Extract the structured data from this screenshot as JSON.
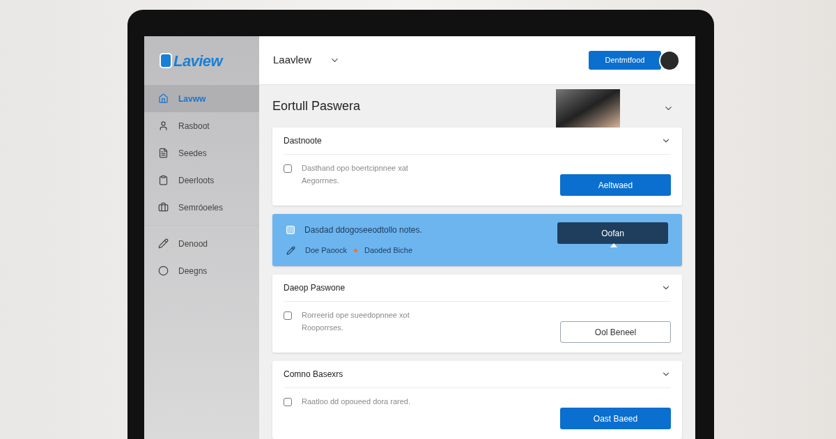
{
  "app": {
    "logo": "Laview"
  },
  "sidebar": {
    "groups": [
      [
        {
          "label": "Lavww",
          "selected": true
        },
        {
          "label": "Rasboot",
          "selected": false
        },
        {
          "label": "Seedes",
          "selected": false
        },
        {
          "label": "Deerloots",
          "selected": false
        },
        {
          "label": "Semróoeles",
          "selected": false
        }
      ],
      [
        {
          "label": "Denood",
          "selected": false
        },
        {
          "label": "Deegns",
          "selected": false
        }
      ]
    ]
  },
  "header": {
    "workspace": "Laavlew",
    "button": "Dentmtfood"
  },
  "page": {
    "title": "Eortull Paswera"
  },
  "cards": [
    {
      "kind": "card",
      "title": "Dastnoote",
      "checked": false,
      "lines": [
        "Dasthand opo boertcipnnee xat",
        "Aegorrnes."
      ],
      "button": {
        "label": "Aeltwaed",
        "kind": "primary"
      }
    },
    {
      "kind": "banner",
      "lines": [
        "Dasdad ddogoseeodtollo notes."
      ],
      "meta": [
        "Doe Paoock",
        "Daoded Biche"
      ],
      "button": {
        "label": "Oofan",
        "kind": "dark"
      }
    },
    {
      "kind": "card",
      "title": "Daeop Paswone",
      "checked": false,
      "lines": [
        "Rorreerid ope sueedopnnee xot",
        "Rooporrses."
      ],
      "button": {
        "label": "Ool Beneel",
        "kind": "outline"
      }
    },
    {
      "kind": "card",
      "title": "Comno Basexrs",
      "checked": false,
      "lines": [
        "Raatloo dd opoueed dora rared."
      ],
      "button": {
        "label": "Oast Baeed",
        "kind": "primary"
      }
    }
  ]
}
